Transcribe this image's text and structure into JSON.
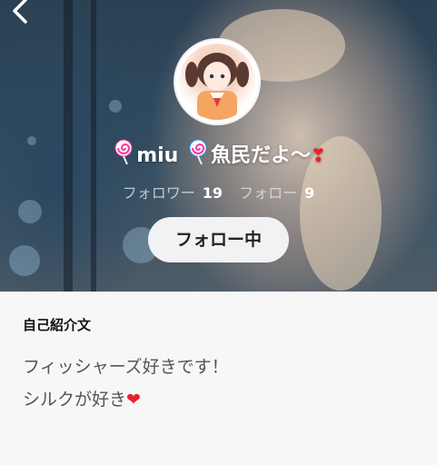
{
  "header": {
    "back_icon": "chevron-left-icon",
    "avatar": "avatar-icon"
  },
  "profile": {
    "name_part1": "miu",
    "name_part2": "魚民だよ〜",
    "name_emoji_left": "candy-icon",
    "name_emoji_right": "heart-exclamation-icon",
    "followers_label": "フォロワー",
    "followers_count": "19",
    "following_label": "フォロー",
    "following_count": "9",
    "follow_button_label": "フォロー中"
  },
  "bio": {
    "title": "自己紹介文",
    "line1": "フィッシャーズ好きです！",
    "line2": "シルクが好き",
    "line2_emoji": "heart-icon"
  },
  "colors": {
    "accent_heart": "#e8202b",
    "button_bg": "#f2f2f4",
    "bio_bg": "#f7f7f7"
  }
}
